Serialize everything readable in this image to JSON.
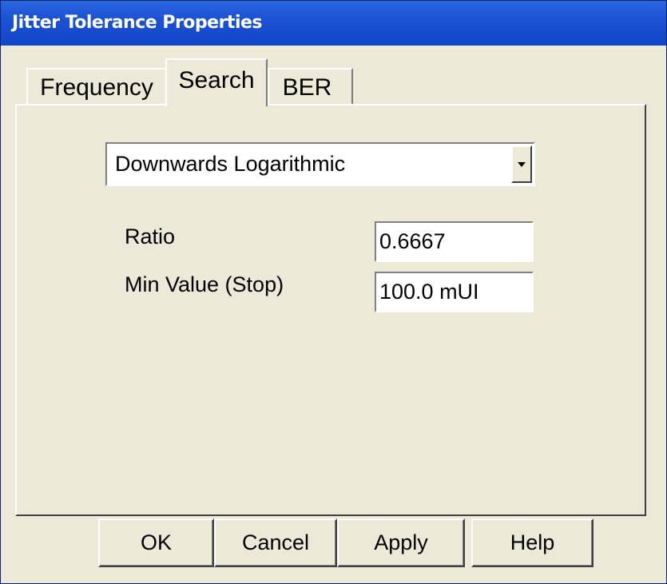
{
  "window": {
    "title": "Jitter Tolerance Properties"
  },
  "tabs": [
    {
      "label": "Frequency",
      "selected": false
    },
    {
      "label": "Search",
      "selected": true
    },
    {
      "label": "BER",
      "selected": false
    }
  ],
  "search": {
    "mode_select": {
      "value": "Downwards Logarithmic",
      "icon": "chevron-down-icon"
    },
    "ratio": {
      "label": "Ratio",
      "value": "0.6667"
    },
    "min_value": {
      "label": "Min Value (Stop)",
      "value": "100.0 mUI"
    }
  },
  "buttons": {
    "ok": "OK",
    "cancel": "Cancel",
    "apply": "Apply",
    "help": "Help"
  },
  "colors": {
    "title_bar": "#1C52D6",
    "dialog_background": "#ECE9D8"
  }
}
